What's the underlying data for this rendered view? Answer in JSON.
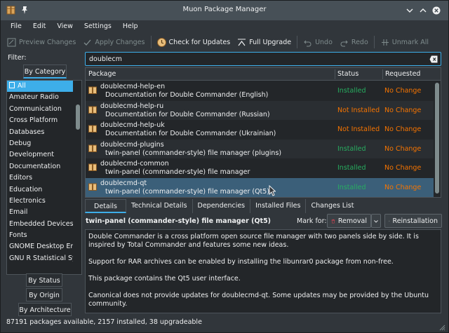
{
  "window": {
    "title": "Muon Package Manager"
  },
  "menu": [
    "File",
    "Edit",
    "View",
    "Settings",
    "Help"
  ],
  "toolbar": {
    "preview_changes": "Preview Changes",
    "apply_changes": "Apply Changes",
    "check_updates": "Check for Updates",
    "full_upgrade": "Full Upgrade",
    "undo": "Undo",
    "redo": "Redo",
    "unmark_all": "Unmark All"
  },
  "filter": {
    "label": "Filter:",
    "tabs": {
      "by_category": "By Category",
      "by_status": "By Status",
      "by_origin": "By Origin",
      "by_architecture": "By Architecture"
    },
    "categories": [
      "All",
      "Amateur Radio",
      "Communication",
      "Cross Platform",
      "Databases",
      "Debug",
      "Development",
      "Documentation",
      "Editors",
      "Education",
      "Electronics",
      "Email",
      "Embedded Devices",
      "Fonts",
      "GNOME Desktop Envi",
      "GNU R Statistical Syst"
    ],
    "selected_category": "All"
  },
  "search": {
    "value": "doublecm"
  },
  "packages": {
    "columns": {
      "package": "Package",
      "status": "Status",
      "requested": "Requested"
    },
    "rows": [
      {
        "name": "doublecmd-help-en",
        "description": "Documentation for Double Commander (English)",
        "status": "Installed",
        "requested": "No Change"
      },
      {
        "name": "doublecmd-help-ru",
        "description": "Documentation for Double Commander (Russian)",
        "status": "Not Installed",
        "requested": "No Change"
      },
      {
        "name": "doublecmd-help-uk",
        "description": "Documentation for Double Commander (Ukrainian)",
        "status": "Not Installed",
        "requested": "No Change"
      },
      {
        "name": "doublecmd-plugins",
        "description": "twin-panel (commander-style) file manager (plugins)",
        "status": "Installed",
        "requested": "No Change"
      },
      {
        "name": "doublecmd-common",
        "description": "twin-panel (commander-style) file manager",
        "status": "Installed",
        "requested": "No Change"
      },
      {
        "name": "doublecmd-qt",
        "description": "twin-panel (commander-style) file manager (Qt5)",
        "status": "Installed",
        "requested": "No Change"
      }
    ],
    "selected_index": 5
  },
  "details": {
    "tabs": [
      "Details",
      "Technical Details",
      "Dependencies",
      "Installed Files",
      "Changes List"
    ],
    "title": "twin-panel (commander-style) file manager (Qt5)",
    "mark_for": "Mark for:",
    "removal": "Removal",
    "reinstallation": "Reinstallation",
    "paragraphs": [
      "Double Commander is a cross platform open source file manager with two panels side by side. It is inspired by Total Commander and features some new ideas.",
      "Support for RAR archives can be enabled by installing the libunrar0 package from non-free.",
      "This package contains the Qt5 user interface.",
      "Canonical does not provide updates for doublecmd-qt. Some updates may be provided by the Ubuntu community."
    ]
  },
  "statusbar": {
    "text": "87191 packages available, 2157 installed, 38 upgradeable"
  },
  "colors": {
    "accent": "#3daee9",
    "installed": "#27ae60",
    "not_installed": "#f67400",
    "background": "#31363b",
    "view": "#232629"
  }
}
